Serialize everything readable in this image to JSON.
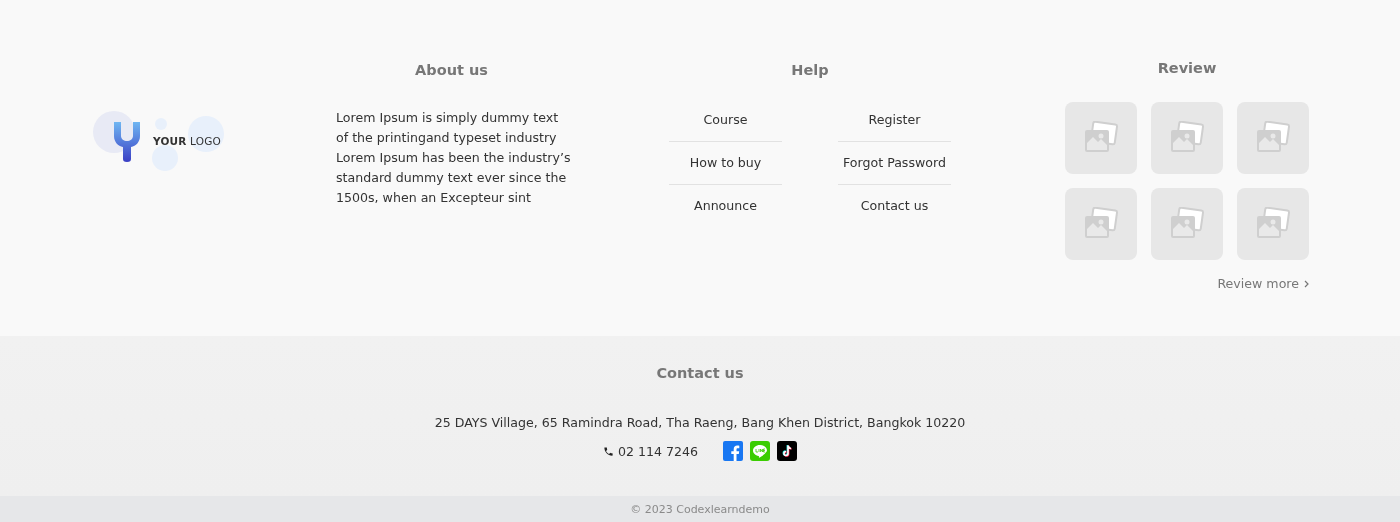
{
  "logo": {
    "text": "**YOUR** LOGO"
  },
  "about": {
    "title": "About us",
    "lines": [
      "Lorem Ipsum is  simply dummy text",
      "of  the printingand  typeset industry",
      "Lorem Ipsum has been the industry’s",
      "standard  dummy  text ever since the",
      "1500s, when an Excepteur sint"
    ]
  },
  "help": {
    "title": "Help",
    "columns": [
      [
        "Course",
        "How to buy",
        "Announce"
      ],
      [
        "Register",
        "Forgot  Password",
        "Contact us"
      ]
    ]
  },
  "review": {
    "title": "Review",
    "more": "Review more"
  },
  "contact": {
    "title": "Contact us",
    "address": "25 DAYS Village, 65 Ramindra Road, Tha Raeng, Bang Khen District, Bangkok 10220",
    "phone": "02 114 7246",
    "socials": [
      {
        "kind": "facebook"
      },
      {
        "kind": "line"
      },
      {
        "kind": "tiktok"
      }
    ]
  },
  "copyright": "© 2023 Codexlearndemo"
}
